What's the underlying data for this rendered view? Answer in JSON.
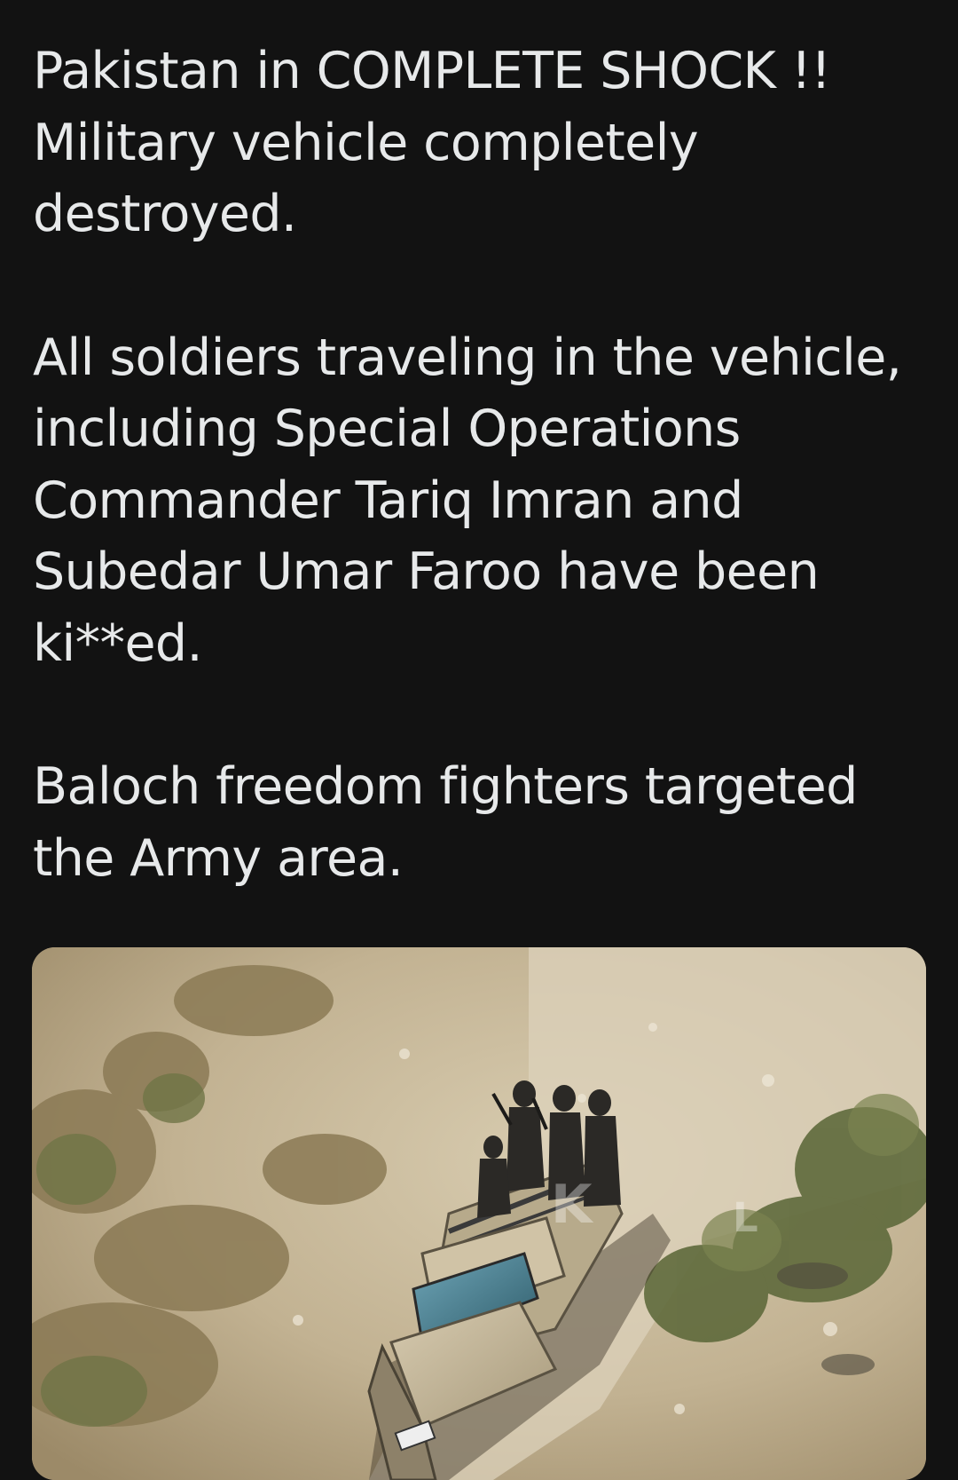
{
  "post": {
    "paragraphs": [
      {
        "lines": [
          "Pakistan in COMPLETE SHOCK !!",
          "Military vehicle completely",
          "destroyed."
        ]
      },
      {
        "lines": [
          "All soldiers traveling in the vehicle,",
          "including Special Operations",
          "Commander Tariq Imran and",
          "Subedar Umar Faroo have been",
          "ki**ed."
        ]
      },
      {
        "lines": [
          "Baloch freedom fighters targeted",
          "the Army area."
        ]
      }
    ]
  },
  "media": {
    "type": "video-still",
    "subject": "aerial view of pickup truck with soldiers on rocky hillside"
  }
}
